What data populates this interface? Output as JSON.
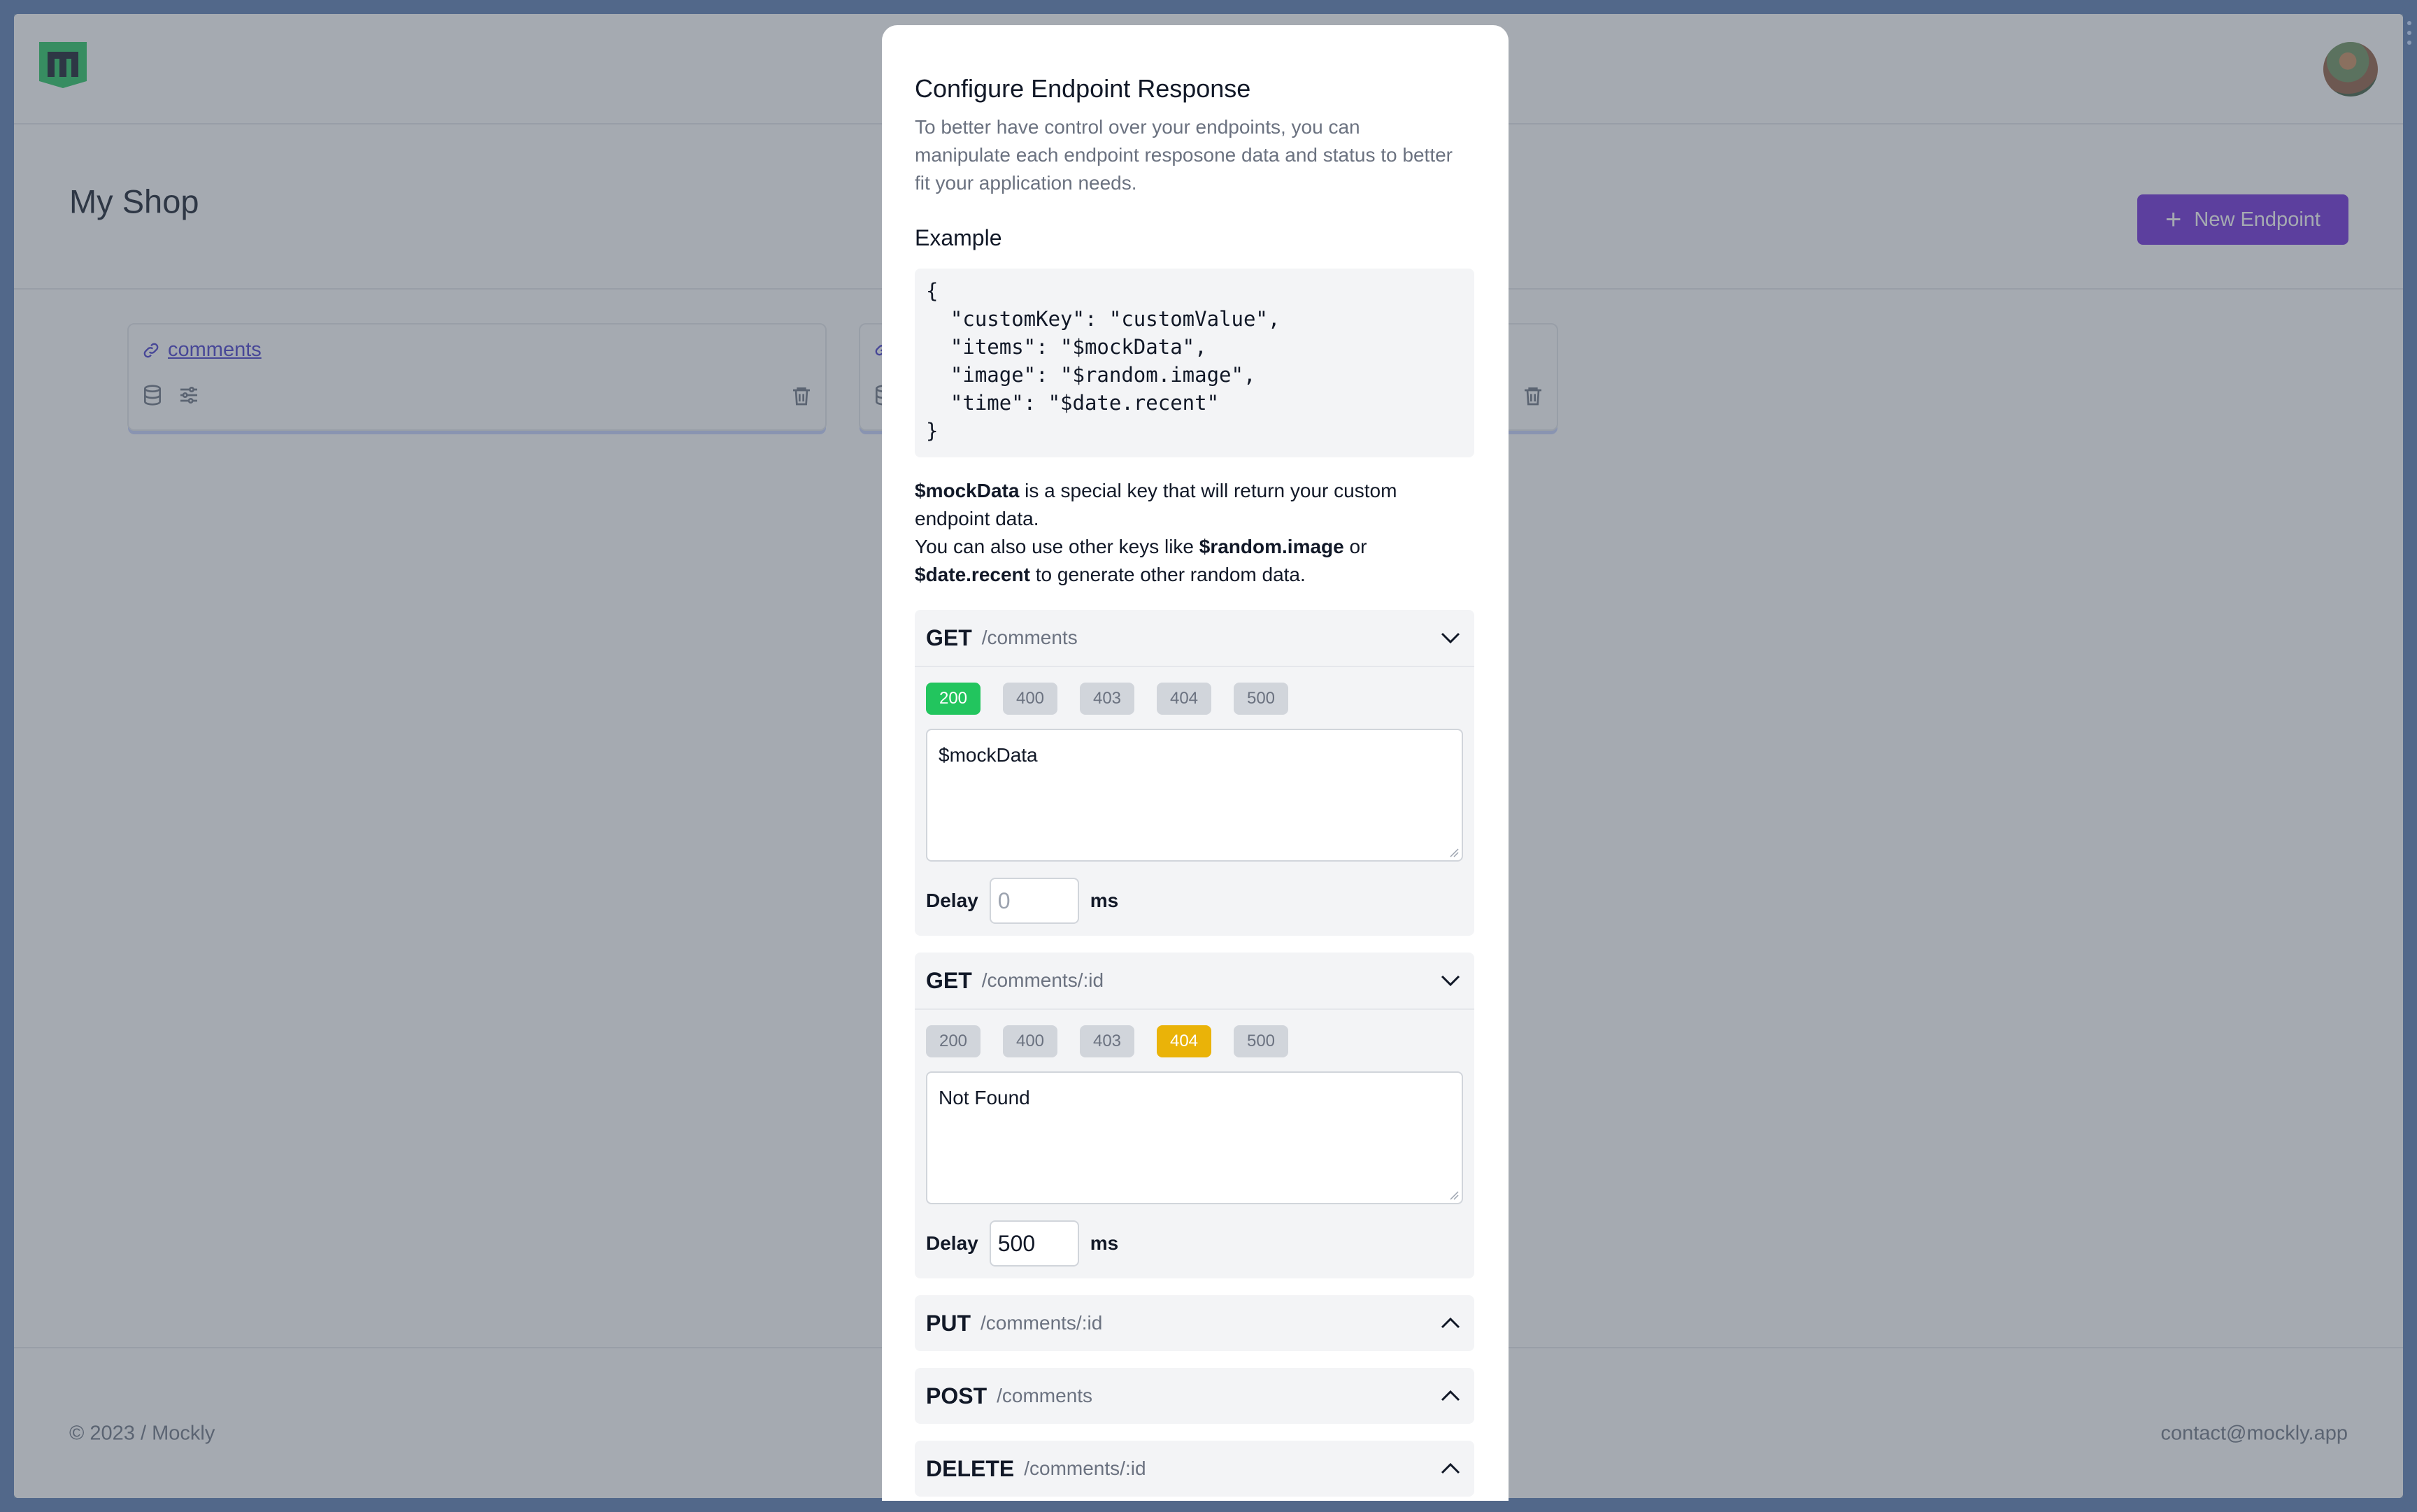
{
  "app": {
    "name": "Mockly"
  },
  "shop": {
    "title": "My Shop",
    "new_endpoint_label": "New Endpoint"
  },
  "cards": [
    {
      "label": "comments"
    },
    {
      "label": ""
    }
  ],
  "footer": {
    "copyright": "© 2023 / Mockly",
    "contact": "contact@mockly.app"
  },
  "modal": {
    "title": "Configure Endpoint Response",
    "description": "To better have control over your endpoints, you can manipulate each endpoint resposone data and status to better fit your application needs.",
    "example_label": "Example",
    "code_lines": [
      "{",
      "  \"customKey\": \"customValue\",",
      "  \"items\": \"$mockData\",",
      "  \"image\": \"$random.image\",",
      "  \"time\": \"$date.recent\"",
      "}"
    ],
    "note": {
      "key1": "$mockData",
      "text1": " is a special key that will return your custom endpoint data.",
      "text2": "You can also use other keys like ",
      "key2": "$random.image",
      "text3": " or ",
      "key3": "$date.recent",
      "text4": " to generate other random data."
    },
    "status_codes": [
      "200",
      "400",
      "403",
      "404",
      "500"
    ],
    "delay_label": "Delay",
    "ms_label": "ms",
    "endpoints": [
      {
        "method": "GET",
        "path": "/comments",
        "expanded": true,
        "active_status": "200",
        "response": "$mockData",
        "delay_value": "",
        "delay_placeholder": "0"
      },
      {
        "method": "GET",
        "path": "/comments/:id",
        "expanded": true,
        "active_status": "404",
        "response": "Not Found",
        "delay_value": "500",
        "delay_placeholder": "0"
      },
      {
        "method": "PUT",
        "path": "/comments/:id",
        "expanded": false
      },
      {
        "method": "POST",
        "path": "/comments",
        "expanded": false
      },
      {
        "method": "DELETE",
        "path": "/comments/:id",
        "expanded": false
      }
    ]
  },
  "colors": {
    "accent": "#6d28d9",
    "status_ok": "#22c55e",
    "status_warn": "#eab308",
    "logo": "#22c55e"
  }
}
